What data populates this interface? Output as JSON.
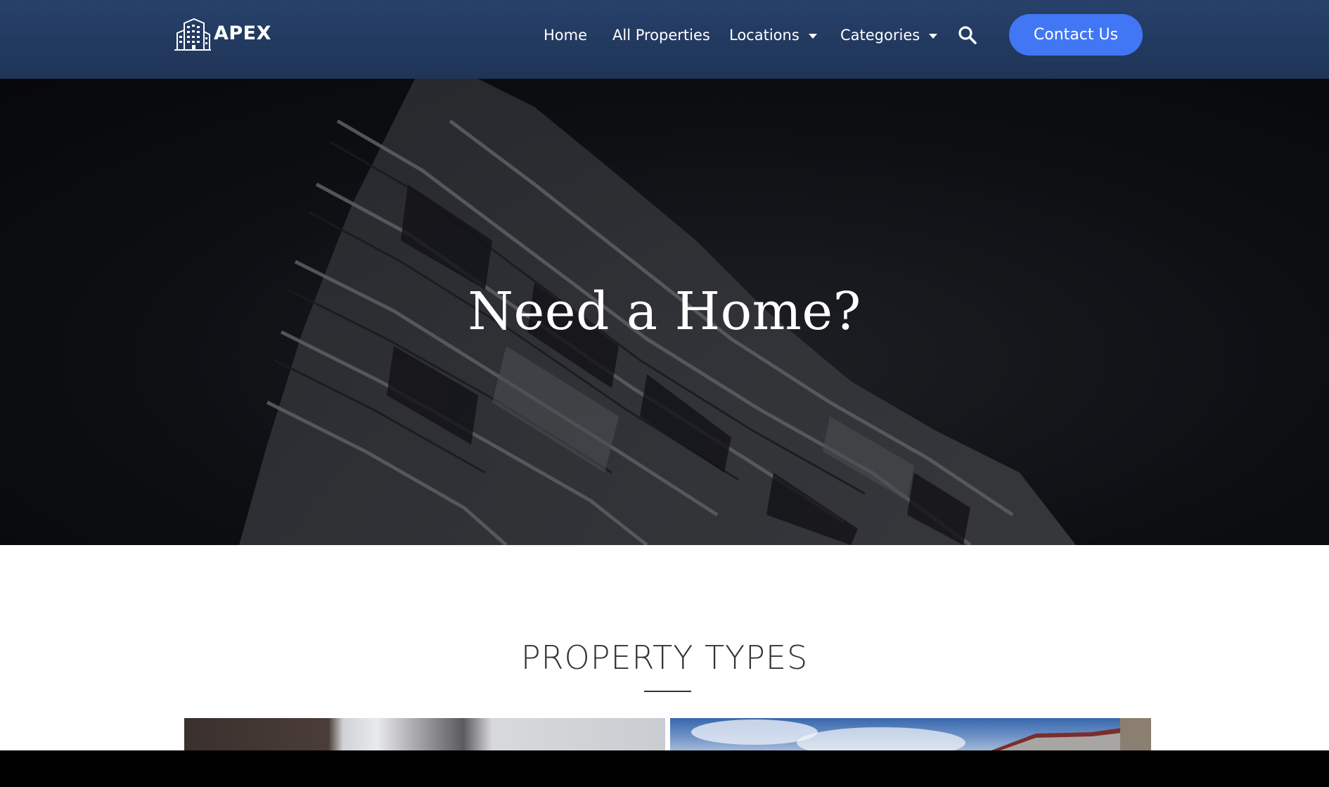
{
  "header": {
    "logo_text": "APEX",
    "logo_icon": "building-icon",
    "nav": [
      {
        "label": "Home",
        "has_dropdown": false
      },
      {
        "label": "All Properties",
        "has_dropdown": false
      },
      {
        "label": "Locations",
        "has_dropdown": true
      },
      {
        "label": "Categories",
        "has_dropdown": true
      }
    ],
    "search_icon": "search-icon",
    "contact_label": "Contact Us"
  },
  "hero": {
    "title": "Need a Home?"
  },
  "property_types": {
    "title": "PROPERTY TYPES"
  },
  "colors": {
    "header_bg": "#233a60",
    "accent": "#4177f4",
    "text_dark": "#333333"
  }
}
